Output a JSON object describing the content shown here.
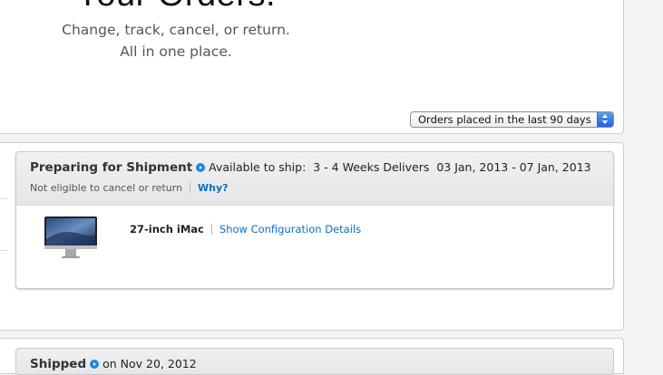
{
  "hero": {
    "title": "Your Orders.",
    "subtitle_line1": "Change, track, cancel, or return.",
    "subtitle_line2": "All in one place."
  },
  "filter": {
    "selected": "Orders placed in the last 90 days"
  },
  "order": {
    "status": "Preparing for Shipment",
    "availability_label": "Available to ship:",
    "availability_value": "3 - 4 Weeks",
    "delivers_label": "Delivers",
    "delivers_value": "03 Jan, 2013 - 07 Jan, 2013",
    "cancel_note": "Not eligible to cancel or return",
    "why_link": "Why?",
    "product": {
      "name": "27-inch iMac",
      "config_link": "Show Configuration Details"
    }
  },
  "shipped": {
    "status": "Shipped",
    "date_text": "on Nov 20, 2012"
  },
  "colors": {
    "link": "#0a6fc4",
    "status_icon": "#1f86d8",
    "select_arrows": "#1f63d8"
  },
  "icons": {
    "status_arrow": "arrow-circle-right-icon",
    "select_arrows": "select-updown-icon",
    "product_image": "imac-icon"
  }
}
